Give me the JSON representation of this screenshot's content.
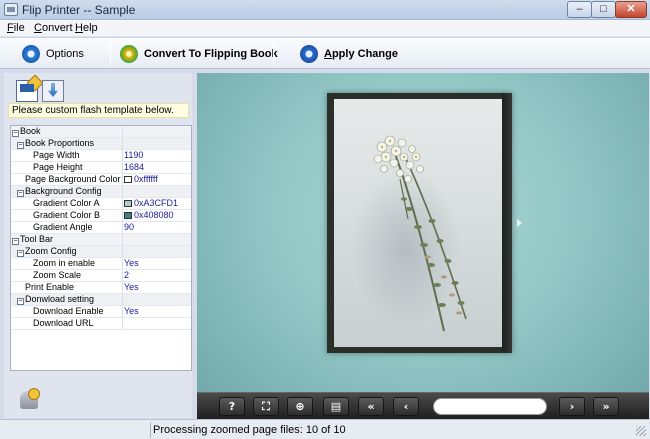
{
  "window": {
    "title": "Flip Printer -- Sample",
    "min": "–",
    "max": "□",
    "close": "✕"
  },
  "menu": [
    "File",
    "Convert",
    "Help"
  ],
  "toolbar": {
    "options": "Options",
    "convert": "Convert To Flipping Book",
    "apply": "Apply Change"
  },
  "left": {
    "tip": "Please custom flash template below."
  },
  "properties": [
    {
      "level": 0,
      "expand": "−",
      "name": "Book",
      "value": "",
      "kind": "cat"
    },
    {
      "level": 1,
      "expand": "−",
      "name": "Book Proportions",
      "value": "",
      "kind": "sub"
    },
    {
      "level": 2,
      "name": "Page Width",
      "value": "1190"
    },
    {
      "level": 2,
      "name": "Page Height",
      "value": "1684"
    },
    {
      "level": 1.5,
      "name": "Page Background Color",
      "value": "0xffffff",
      "swatch": "#ffffff"
    },
    {
      "level": 1,
      "expand": "−",
      "name": "Background Config",
      "value": "",
      "kind": "sub"
    },
    {
      "level": 2,
      "name": "Gradient Color A",
      "value": "0xA3CFD1",
      "swatch": "#A3CFD1"
    },
    {
      "level": 2,
      "name": "Gradient Color B",
      "value": "0x408080",
      "swatch": "#408080"
    },
    {
      "level": 2,
      "name": "Gradient Angle",
      "value": "90"
    },
    {
      "level": 0,
      "expand": "−",
      "name": "Tool Bar",
      "value": "",
      "kind": "cat"
    },
    {
      "level": 1,
      "expand": "−",
      "name": "Zoom Config",
      "value": "",
      "kind": "sub"
    },
    {
      "level": 2,
      "name": "Zoom in enable",
      "value": "Yes"
    },
    {
      "level": 2,
      "name": "Zoom Scale",
      "value": "2"
    },
    {
      "level": 1.5,
      "name": "Print Enable",
      "value": "Yes"
    },
    {
      "level": 1,
      "expand": "−",
      "name": "Donwload setting",
      "value": "",
      "kind": "sub"
    },
    {
      "level": 2,
      "name": "Download Enable",
      "value": "Yes"
    },
    {
      "level": 2,
      "name": "Download URL",
      "value": ""
    }
  ],
  "player": {
    "help": "?",
    "fit": "⛶",
    "zoom": "⊕",
    "print": "▤",
    "first": "«",
    "prev": "‹",
    "page_value": "",
    "next": "›",
    "last": "»"
  },
  "colors": {
    "preview_bg": "#A3CFD1",
    "preview_bg_dark": "#408080"
  },
  "status": {
    "text": "Processing zoomed page files: 10 of 10"
  }
}
